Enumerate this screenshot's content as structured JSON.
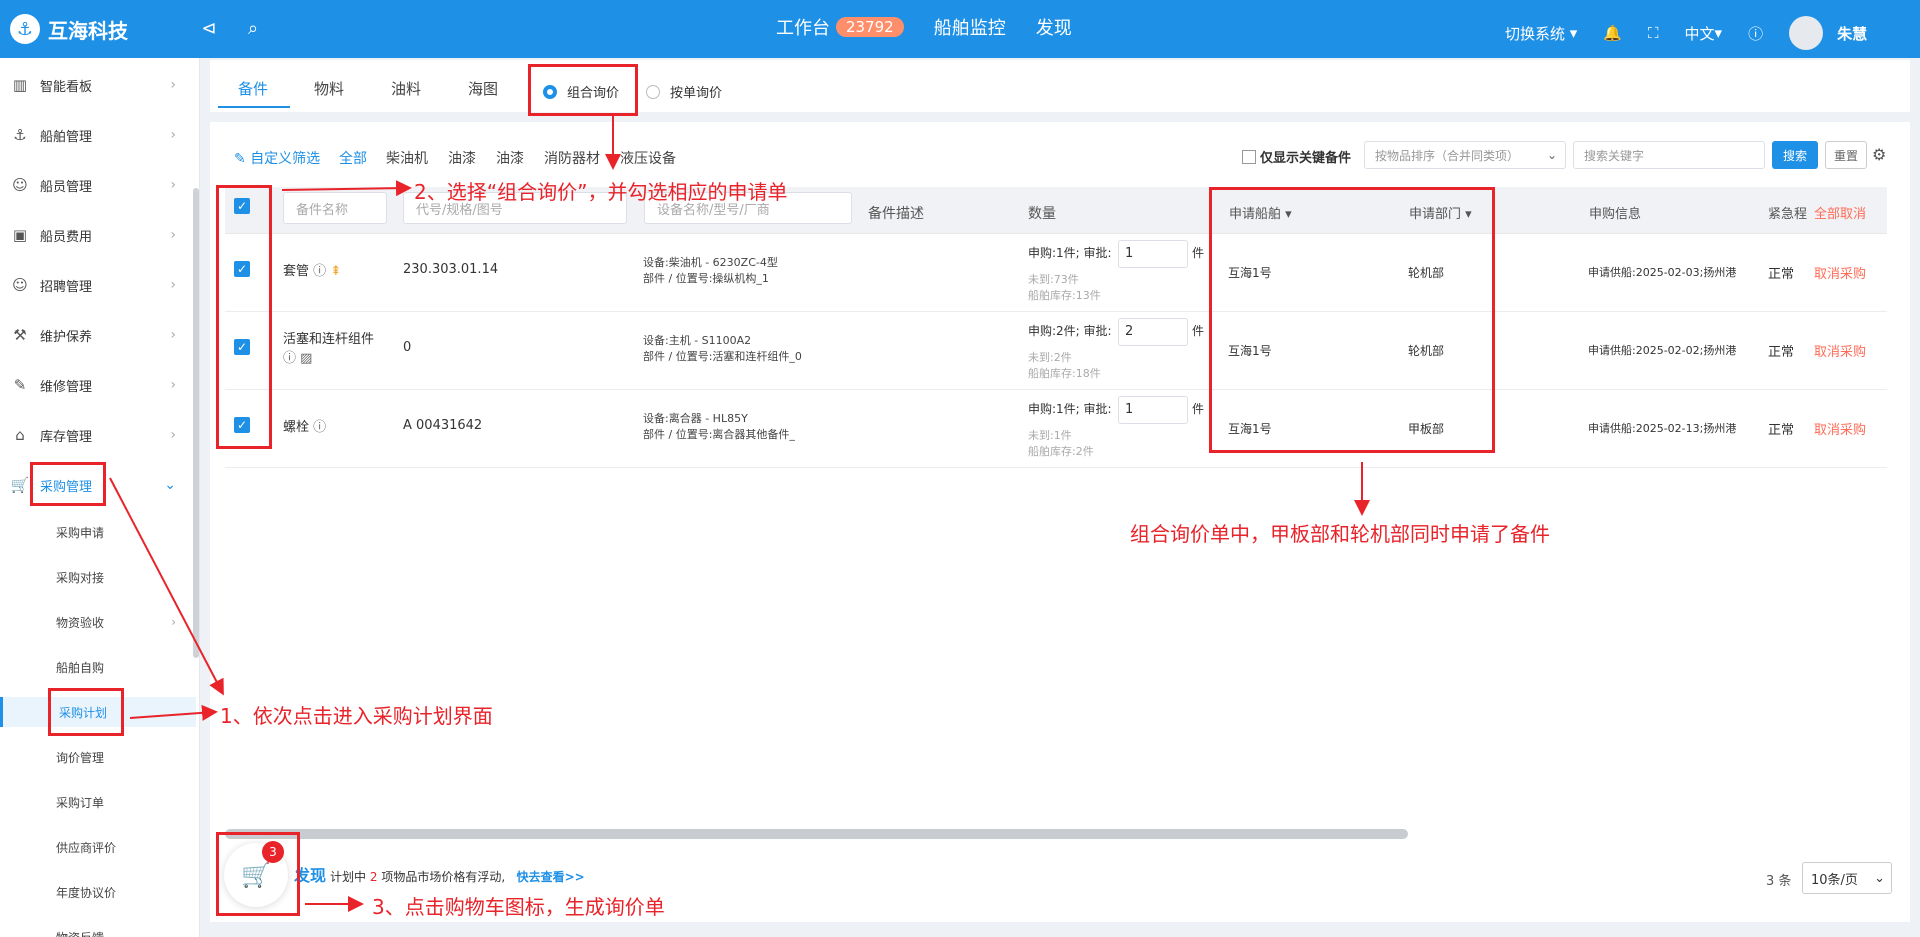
{
  "app": {
    "name": "互海科技"
  },
  "topnav": {
    "workbench": "工作台",
    "workbench_count": "23792",
    "ship_monitor": "船舶监控",
    "discover": "发现"
  },
  "topright": {
    "switch_system": "切换系统",
    "lang": "中文",
    "user": "朱慧"
  },
  "sidebar": {
    "items": [
      "智能看板",
      "船舶管理",
      "船员管理",
      "船员费用",
      "招聘管理",
      "维护保养",
      "维修管理",
      "库存管理",
      "采购管理"
    ],
    "subitems": [
      "采购申请",
      "采购对接",
      "物资验收",
      "船舶自购",
      "采购计划",
      "询价管理",
      "采购订单",
      "供应商评价",
      "年度协议价",
      "物资反馈"
    ]
  },
  "tabs": {
    "t1": "备件",
    "t2": "物料",
    "t3": "油料",
    "t4": "海图",
    "radio1": "组合询价",
    "radio2": "按单询价"
  },
  "filters": {
    "custom": "自定义筛选",
    "all": "全部",
    "f1": "柴油机",
    "f2": "油漆",
    "f3": "油漆",
    "f4": "消防器材",
    "f5": "液压设备"
  },
  "toolbar": {
    "key_only": "仅显示关键备件",
    "sort_placeholder": "按物品排序（合并同类项）",
    "search_placeholder": "搜索关键字",
    "search": "搜索",
    "reset": "重置"
  },
  "table": {
    "ph_name": "备件名称",
    "ph_code": "代号/规格/图号",
    "ph_device": "设备名称/型号/厂商",
    "h_desc": "备件描述",
    "h_qty": "数量",
    "h_ship": "申请船舶",
    "h_dept": "申请部门",
    "h_info": "申购信息",
    "h_urgent": "紧急程",
    "h_cancel_all": "全部取消",
    "rows": [
      {
        "name": "套管",
        "code": "230.303.01.14",
        "device": "设备:柴油机 - 6230ZC-4型",
        "part": "部件 / 位置号:操纵机构_1",
        "req": "申购:1件; 审批:",
        "approve": "1",
        "unit": "件",
        "arrive": "未到:73件",
        "stock": "船舶库存:13件",
        "ship": "互海1号",
        "dept": "轮机部",
        "info": "申请供船:2025-02-03;扬州港",
        "urgent": "正常",
        "action": "取消采购"
      },
      {
        "name": "活塞和连杆组件",
        "code": "0",
        "device": "设备:主机 - S1100A2",
        "part": "部件 / 位置号:活塞和连杆组件_0",
        "req": "申购:2件; 审批:",
        "approve": "2",
        "unit": "件",
        "arrive": "未到:2件",
        "stock": "船舶库存:18件",
        "ship": "互海1号",
        "dept": "轮机部",
        "info": "申请供船:2025-02-02;扬州港",
        "urgent": "正常",
        "action": "取消采购"
      },
      {
        "name": "螺栓",
        "code": "A 00431642",
        "device": "设备:离合器 - HL85Y",
        "part": "部件 / 位置号:离合器其他备件_",
        "req": "申购:1件; 审批:",
        "approve": "1",
        "unit": "件",
        "arrive": "未到:1件",
        "stock": "船舶库存:2件",
        "ship": "互海1号",
        "dept": "甲板部",
        "info": "申请供船:2025-02-13;扬州港",
        "urgent": "正常",
        "action": "取消采购"
      }
    ]
  },
  "footer": {
    "cart_count": "3",
    "discover": "发现",
    "msg_prefix": "计划中",
    "msg_count": "2",
    "msg_suffix": "项物品市场价格有浮动,",
    "msg_link": "快去查看>>",
    "total": "3 条",
    "page_size": "10条/页"
  },
  "annotations": {
    "a1": "1、依次点击进入采购计划界面",
    "a2": "2、选择“组合询价”，并勾选相应的申请单",
    "a3": "3、点击购物车图标，生成询价单",
    "a4": "组合询价单中，甲板部和轮机部同时申请了备件"
  },
  "colors": {
    "primary": "#1e90e6",
    "annotation": "#e8232a",
    "cancel": "#ff6b57"
  }
}
